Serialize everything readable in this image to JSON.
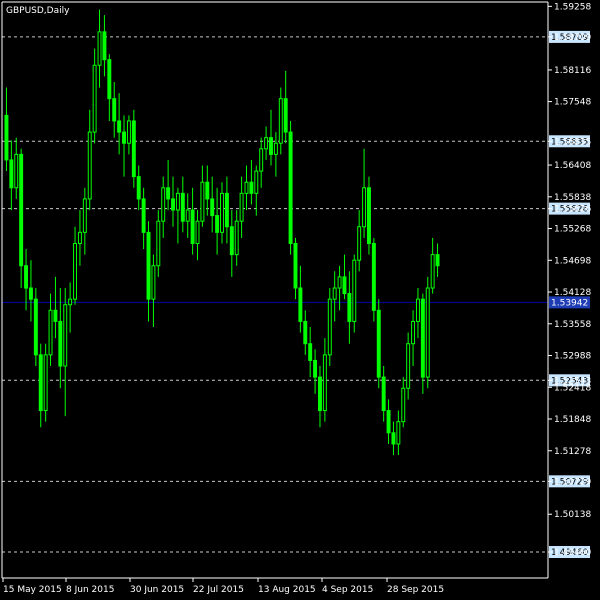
{
  "chart_data": {
    "type": "candlestick",
    "title": "GBPUSD,Daily",
    "symbol": "GBPUSD",
    "timeframe": "Daily",
    "price_ticks": [
      "1.59258",
      "1.58709",
      "1.58116",
      "1.57548",
      "1.56835",
      "1.56408",
      "1.55838",
      "1.55626",
      "1.55268",
      "1.54698",
      "1.54128",
      "1.53558",
      "1.52988",
      "1.52543",
      "1.52418",
      "1.51848",
      "1.51278",
      "1.50729",
      "1.50138",
      "1.49460"
    ],
    "highlight_levels": [
      "1.58709",
      "1.56835",
      "1.55626",
      "1.52543",
      "1.50729",
      "1.49460"
    ],
    "current_price_label": "1.53942",
    "date_labels": [
      "15 May 2015",
      "8 Jun 2015",
      "30 Jun 2015",
      "22 Jul 2015",
      "13 Aug 2015",
      "4 Sep 2015",
      "28 Sep 2015"
    ],
    "ylim": [
      1.4946,
      1.593
    ],
    "grid": false,
    "colors": {
      "background": "#000000",
      "candle": "#00ff00",
      "axis": "#ffffff",
      "level_line": "#c8c8c8",
      "current_line": "#0000aa",
      "current_box": "#1e3cb4",
      "level_box": "#c8e6ff"
    },
    "candles": [
      {
        "o": 1.573,
        "h": 1.578,
        "l": 1.563,
        "c": 1.565
      },
      {
        "o": 1.565,
        "h": 1.5685,
        "l": 1.556,
        "c": 1.56
      },
      {
        "o": 1.56,
        "h": 1.569,
        "l": 1.558,
        "c": 1.566
      },
      {
        "o": 1.566,
        "h": 1.567,
        "l": 1.542,
        "c": 1.546
      },
      {
        "o": 1.546,
        "h": 1.549,
        "l": 1.538,
        "c": 1.542
      },
      {
        "o": 1.542,
        "h": 1.547,
        "l": 1.536,
        "c": 1.54
      },
      {
        "o": 1.54,
        "h": 1.542,
        "l": 1.528,
        "c": 1.53
      },
      {
        "o": 1.53,
        "h": 1.532,
        "l": 1.517,
        "c": 1.52
      },
      {
        "o": 1.52,
        "h": 1.532,
        "l": 1.518,
        "c": 1.53
      },
      {
        "o": 1.53,
        "h": 1.541,
        "l": 1.528,
        "c": 1.538
      },
      {
        "o": 1.538,
        "h": 1.544,
        "l": 1.533,
        "c": 1.536
      },
      {
        "o": 1.536,
        "h": 1.542,
        "l": 1.524,
        "c": 1.528
      },
      {
        "o": 1.528,
        "h": 1.542,
        "l": 1.519,
        "c": 1.539
      },
      {
        "o": 1.539,
        "h": 1.543,
        "l": 1.534,
        "c": 1.54
      },
      {
        "o": 1.54,
        "h": 1.553,
        "l": 1.539,
        "c": 1.55
      },
      {
        "o": 1.55,
        "h": 1.556,
        "l": 1.546,
        "c": 1.552
      },
      {
        "o": 1.552,
        "h": 1.56,
        "l": 1.548,
        "c": 1.558
      },
      {
        "o": 1.558,
        "h": 1.574,
        "l": 1.556,
        "c": 1.57
      },
      {
        "o": 1.57,
        "h": 1.585,
        "l": 1.568,
        "c": 1.582
      },
      {
        "o": 1.582,
        "h": 1.592,
        "l": 1.578,
        "c": 1.588
      },
      {
        "o": 1.588,
        "h": 1.591,
        "l": 1.58,
        "c": 1.583
      },
      {
        "o": 1.583,
        "h": 1.584,
        "l": 1.572,
        "c": 1.576
      },
      {
        "o": 1.576,
        "h": 1.579,
        "l": 1.569,
        "c": 1.572
      },
      {
        "o": 1.572,
        "h": 1.577,
        "l": 1.566,
        "c": 1.57
      },
      {
        "o": 1.57,
        "h": 1.573,
        "l": 1.562,
        "c": 1.568
      },
      {
        "o": 1.568,
        "h": 1.573,
        "l": 1.566,
        "c": 1.572
      },
      {
        "o": 1.572,
        "h": 1.574,
        "l": 1.56,
        "c": 1.562
      },
      {
        "o": 1.562,
        "h": 1.564,
        "l": 1.556,
        "c": 1.558
      },
      {
        "o": 1.558,
        "h": 1.56,
        "l": 1.549,
        "c": 1.552
      },
      {
        "o": 1.552,
        "h": 1.554,
        "l": 1.536,
        "c": 1.54
      },
      {
        "o": 1.54,
        "h": 1.548,
        "l": 1.535,
        "c": 1.546
      },
      {
        "o": 1.546,
        "h": 1.556,
        "l": 1.544,
        "c": 1.554
      },
      {
        "o": 1.554,
        "h": 1.562,
        "l": 1.551,
        "c": 1.56
      },
      {
        "o": 1.56,
        "h": 1.565,
        "l": 1.556,
        "c": 1.558
      },
      {
        "o": 1.558,
        "h": 1.562,
        "l": 1.553,
        "c": 1.556
      },
      {
        "o": 1.556,
        "h": 1.56,
        "l": 1.55,
        "c": 1.559
      },
      {
        "o": 1.559,
        "h": 1.562,
        "l": 1.552,
        "c": 1.554
      },
      {
        "o": 1.554,
        "h": 1.559,
        "l": 1.551,
        "c": 1.556
      },
      {
        "o": 1.556,
        "h": 1.56,
        "l": 1.548,
        "c": 1.55
      },
      {
        "o": 1.55,
        "h": 1.556,
        "l": 1.547,
        "c": 1.554
      },
      {
        "o": 1.554,
        "h": 1.564,
        "l": 1.553,
        "c": 1.561
      },
      {
        "o": 1.561,
        "h": 1.564,
        "l": 1.555,
        "c": 1.558
      },
      {
        "o": 1.558,
        "h": 1.562,
        "l": 1.552,
        "c": 1.555
      },
      {
        "o": 1.555,
        "h": 1.56,
        "l": 1.548,
        "c": 1.552
      },
      {
        "o": 1.552,
        "h": 1.561,
        "l": 1.55,
        "c": 1.559
      },
      {
        "o": 1.559,
        "h": 1.562,
        "l": 1.55,
        "c": 1.553
      },
      {
        "o": 1.553,
        "h": 1.556,
        "l": 1.544,
        "c": 1.548
      },
      {
        "o": 1.548,
        "h": 1.556,
        "l": 1.546,
        "c": 1.554
      },
      {
        "o": 1.554,
        "h": 1.562,
        "l": 1.551,
        "c": 1.559
      },
      {
        "o": 1.559,
        "h": 1.564,
        "l": 1.556,
        "c": 1.561
      },
      {
        "o": 1.561,
        "h": 1.565,
        "l": 1.557,
        "c": 1.559
      },
      {
        "o": 1.559,
        "h": 1.564,
        "l": 1.555,
        "c": 1.563
      },
      {
        "o": 1.563,
        "h": 1.569,
        "l": 1.56,
        "c": 1.567
      },
      {
        "o": 1.567,
        "h": 1.571,
        "l": 1.565,
        "c": 1.569
      },
      {
        "o": 1.569,
        "h": 1.574,
        "l": 1.564,
        "c": 1.566
      },
      {
        "o": 1.566,
        "h": 1.57,
        "l": 1.562,
        "c": 1.568
      },
      {
        "o": 1.568,
        "h": 1.578,
        "l": 1.566,
        "c": 1.576
      },
      {
        "o": 1.576,
        "h": 1.581,
        "l": 1.568,
        "c": 1.57
      },
      {
        "o": 1.57,
        "h": 1.572,
        "l": 1.548,
        "c": 1.55
      },
      {
        "o": 1.55,
        "h": 1.551,
        "l": 1.54,
        "c": 1.542
      },
      {
        "o": 1.542,
        "h": 1.546,
        "l": 1.534,
        "c": 1.536
      },
      {
        "o": 1.536,
        "h": 1.538,
        "l": 1.53,
        "c": 1.532
      },
      {
        "o": 1.532,
        "h": 1.535,
        "l": 1.526,
        "c": 1.529
      },
      {
        "o": 1.529,
        "h": 1.531,
        "l": 1.523,
        "c": 1.526
      },
      {
        "o": 1.526,
        "h": 1.528,
        "l": 1.517,
        "c": 1.52
      },
      {
        "o": 1.52,
        "h": 1.533,
        "l": 1.518,
        "c": 1.53
      },
      {
        "o": 1.53,
        "h": 1.542,
        "l": 1.528,
        "c": 1.54
      },
      {
        "o": 1.54,
        "h": 1.545,
        "l": 1.536,
        "c": 1.542
      },
      {
        "o": 1.542,
        "h": 1.546,
        "l": 1.538,
        "c": 1.544
      },
      {
        "o": 1.544,
        "h": 1.548,
        "l": 1.54,
        "c": 1.541
      },
      {
        "o": 1.541,
        "h": 1.545,
        "l": 1.532,
        "c": 1.536
      },
      {
        "o": 1.536,
        "h": 1.548,
        "l": 1.534,
        "c": 1.547
      },
      {
        "o": 1.547,
        "h": 1.556,
        "l": 1.545,
        "c": 1.553
      },
      {
        "o": 1.553,
        "h": 1.567,
        "l": 1.551,
        "c": 1.56
      },
      {
        "o": 1.56,
        "h": 1.562,
        "l": 1.548,
        "c": 1.55
      },
      {
        "o": 1.55,
        "h": 1.551,
        "l": 1.536,
        "c": 1.538
      },
      {
        "o": 1.538,
        "h": 1.54,
        "l": 1.524,
        "c": 1.526
      },
      {
        "o": 1.526,
        "h": 1.528,
        "l": 1.518,
        "c": 1.52
      },
      {
        "o": 1.52,
        "h": 1.522,
        "l": 1.514,
        "c": 1.516
      },
      {
        "o": 1.516,
        "h": 1.518,
        "l": 1.512,
        "c": 1.514
      },
      {
        "o": 1.514,
        "h": 1.52,
        "l": 1.512,
        "c": 1.518
      },
      {
        "o": 1.518,
        "h": 1.526,
        "l": 1.517,
        "c": 1.524
      },
      {
        "o": 1.524,
        "h": 1.534,
        "l": 1.522,
        "c": 1.532
      },
      {
        "o": 1.532,
        "h": 1.538,
        "l": 1.528,
        "c": 1.536
      },
      {
        "o": 1.536,
        "h": 1.542,
        "l": 1.533,
        "c": 1.54
      },
      {
        "o": 1.54,
        "h": 1.541,
        "l": 1.523,
        "c": 1.526
      },
      {
        "o": 1.526,
        "h": 1.544,
        "l": 1.524,
        "c": 1.542
      },
      {
        "o": 1.542,
        "h": 1.551,
        "l": 1.541,
        "c": 1.548
      },
      {
        "o": 1.548,
        "h": 1.55,
        "l": 1.544,
        "c": 1.546
      }
    ]
  }
}
